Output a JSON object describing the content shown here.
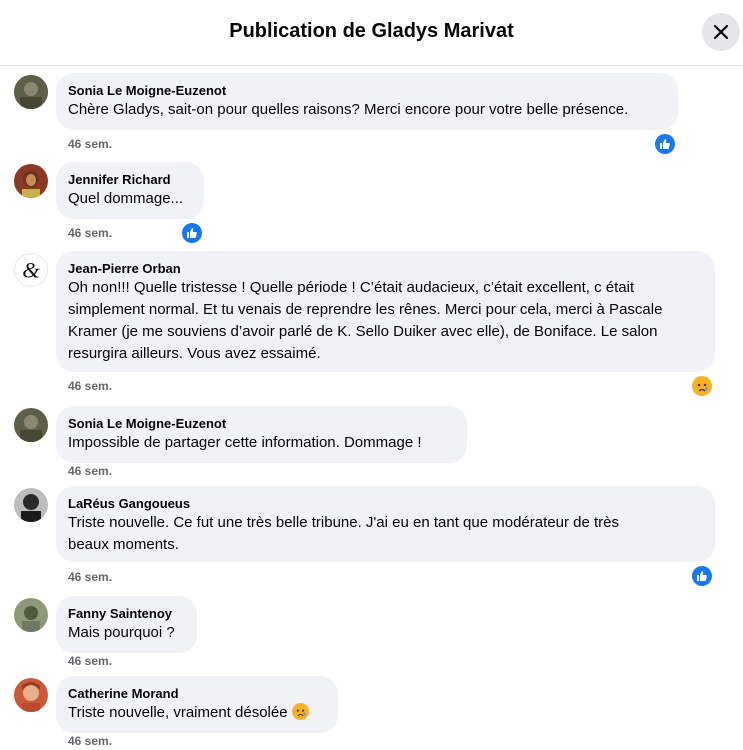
{
  "header": {
    "title": "Publication de Gladys Marivat"
  },
  "comments": [
    {
      "author": "Sonia Le Moigne-Euzenot",
      "text": "Chère Gladys, sait-on pour quelles raisons? Merci encore pour votre belle présence.",
      "time": "46 sem.",
      "reaction": "like"
    },
    {
      "author": "Jennifer Richard",
      "text": "Quel dommage...",
      "time": "46 sem.",
      "reaction": "like"
    },
    {
      "author": "Jean-Pierre Orban",
      "text_lines": [
        "Oh non!!! Quelle tristesse ! Quelle période ! C’était audacieux, c’était excellent, c était",
        "simplement normal. Et tu venais de reprendre les rênes. Merci pour cela, merci à Pascale",
        "Kramer (je me souviens d’avoir parlé de K. Sello Duiker avec elle), de Boniface. Le salon",
        "resurgira ailleurs. Vous avez essaimé."
      ],
      "time": "46 sem.",
      "reaction": "sad"
    },
    {
      "author": "Sonia Le Moigne-Euzenot",
      "text": "Impossible de partager cette information. Dommage !",
      "time": "46 sem."
    },
    {
      "author": "LaRéus Gangoueus",
      "text_lines": [
        "Triste nouvelle. Ce fut une très belle tribune. J'ai eu en tant que modérateur de très",
        "beaux moments."
      ],
      "time": "46 sem.",
      "reaction": "like"
    },
    {
      "author": "Fanny Saintenoy",
      "text": "Mais pourquoi ?",
      "time": "46 sem."
    },
    {
      "author": "Catherine Morand",
      "text": "Triste nouvelle, vraiment désolée",
      "time": "46 sem."
    }
  ]
}
